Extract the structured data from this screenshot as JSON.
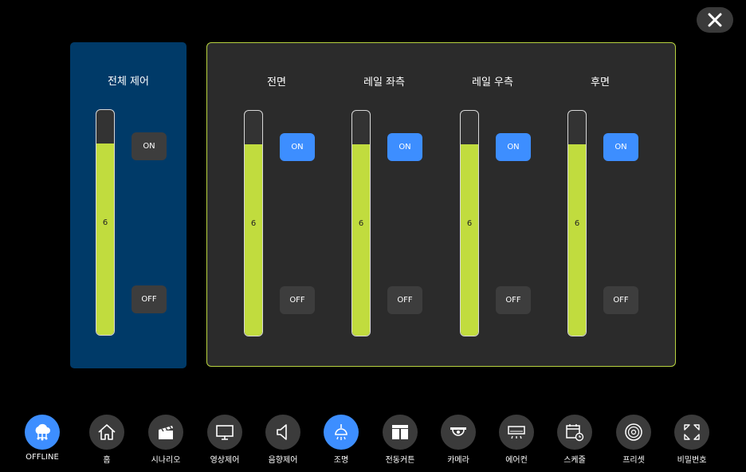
{
  "header": {
    "close_icon": "close-icon"
  },
  "master": {
    "title": "전체 제어",
    "slider_value": "6",
    "level": 0.85,
    "on_label": "ON",
    "off_label": "OFF"
  },
  "zones": [
    {
      "title": "전면",
      "slider_value": "6",
      "level": 0.85,
      "on_label": "ON",
      "off_label": "OFF",
      "on_active": true
    },
    {
      "title": "레일 좌측",
      "slider_value": "6",
      "level": 0.85,
      "on_label": "ON",
      "off_label": "OFF",
      "on_active": true
    },
    {
      "title": "레일 우측",
      "slider_value": "6",
      "level": 0.85,
      "on_label": "ON",
      "off_label": "OFF",
      "on_active": true
    },
    {
      "title": "후면",
      "slider_value": "6",
      "level": 0.85,
      "on_label": "ON",
      "off_label": "OFF",
      "on_active": true
    }
  ],
  "nav": [
    {
      "label": "OFFLINE",
      "icon": "cloud-network-icon",
      "active": true
    },
    {
      "label": "홈",
      "icon": "home-icon",
      "active": false
    },
    {
      "label": "시나리오",
      "icon": "clapperboard-icon",
      "active": false
    },
    {
      "label": "영상제어",
      "icon": "monitor-icon",
      "active": false
    },
    {
      "label": "음향제어",
      "icon": "speaker-icon",
      "active": false
    },
    {
      "label": "조명",
      "icon": "ceiling-lamp-icon",
      "active": true
    },
    {
      "label": "전동커튼",
      "icon": "curtain-icon",
      "active": false
    },
    {
      "label": "카메라",
      "icon": "dome-camera-icon",
      "active": false
    },
    {
      "label": "에어컨",
      "icon": "air-conditioner-icon",
      "active": false
    },
    {
      "label": "스케줄",
      "icon": "calendar-clock-icon",
      "active": false
    },
    {
      "label": "프리셋",
      "icon": "disc-icon",
      "active": false
    },
    {
      "label": "비밀번호",
      "icon": "expand-arrows-icon",
      "active": false
    }
  ],
  "colors": {
    "accent": "#3d8eff",
    "level_fill": "#c1dc3e",
    "master_bg": "#003a68",
    "panel_bg": "#2b2b2b",
    "panel_border": "#b8d33f"
  }
}
